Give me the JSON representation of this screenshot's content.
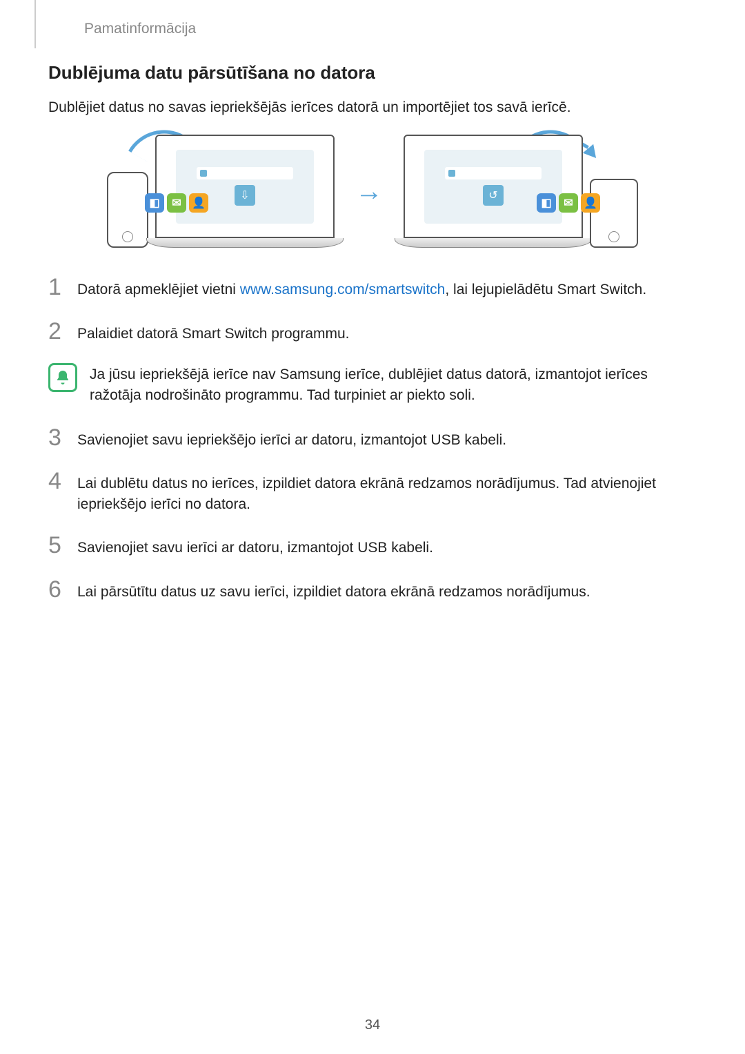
{
  "header": "Pamatinformācija",
  "title": "Dublējuma datu pārsūtīšana no datora",
  "intro": "Dublējiet datus no savas iepriekšējās ierīces datorā un importējiet tos savā ierīcē.",
  "steps": [
    {
      "num": "1",
      "pre": "Datorā apmeklējiet vietni ",
      "link": "www.samsung.com/smartswitch",
      "post": ", lai lejupielādētu Smart Switch."
    },
    {
      "num": "2",
      "text": "Palaidiet datorā Smart Switch programmu."
    },
    {
      "num": "3",
      "text": "Savienojiet savu iepriekšējo ierīci ar datoru, izmantojot USB kabeli."
    },
    {
      "num": "4",
      "text": "Lai dublētu datus no ierīces, izpildiet datora ekrānā redzamos norādījumus. Tad atvienojiet iepriekšējo ierīci no datora."
    },
    {
      "num": "5",
      "text": "Savienojiet savu ierīci ar datoru, izmantojot USB kabeli."
    },
    {
      "num": "6",
      "text": "Lai pārsūtītu datus uz savu ierīci, izpildiet datora ekrānā redzamos norādījumus."
    }
  ],
  "note": "Ja jūsu iepriekšējā ierīce nav Samsung ierīce, dublējiet datus datorā, izmantojot ierīces ražotāja nodrošināto programmu. Tad turpiniet ar piekto soli.",
  "pageNumber": "34",
  "diagram": {
    "left_icon": "backup-icon",
    "right_icon": "restore-icon"
  }
}
